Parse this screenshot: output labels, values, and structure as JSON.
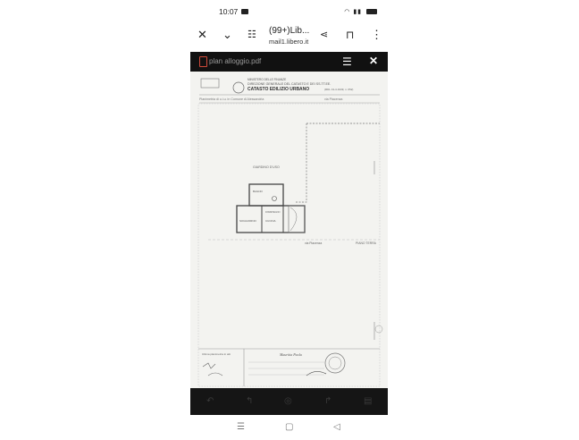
{
  "status_bar": {
    "time": "10:07"
  },
  "toolbar": {
    "title": "(99+)Lib...",
    "subtitle": "mail1.libero.it"
  },
  "pdf_viewer": {
    "file_name": "plan alloggio.pdf"
  },
  "document": {
    "header_ministry": "MINISTERO DELLE FINANZE",
    "header_direction": "DIREZIONE GENERALE DEL CATASTO E DEI SS.TT.EE.",
    "header_title": "CATASTO EDILIZIO URBANO",
    "header_ref": "(RDL 13-4-1939, n. 652)",
    "line_comune": "Planimetria di u.i.u. in Comune di Alessandria",
    "line_via": "via Piacenza",
    "label_garden": "GIARDINO D'USO",
    "label_room1": "SOGGIORNO",
    "label_room2": "CUCINA",
    "label_room3": "BAGNO",
    "label_room4": "DISIMPEGNO",
    "label_street": "via Piacenza",
    "label_floor": "PIANO TERRA",
    "footer_left": "Ultima planimetria in atti",
    "footer_sign": "Mauritia Paola"
  }
}
